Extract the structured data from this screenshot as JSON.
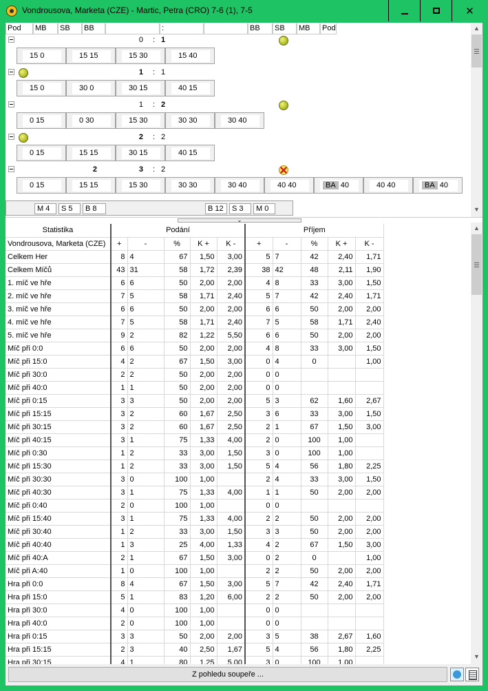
{
  "window": {
    "title": "Vondrousova, Marketa (CZE) - Martic, Petra (CRO) 7-6 (1), 7-5"
  },
  "upper": {
    "header": [
      "Pod",
      "MB",
      "SB",
      "BB",
      "",
      ":",
      "",
      "BB",
      "SB",
      "MB",
      "Pod"
    ],
    "games": [
      {
        "left": "",
        "score": "0",
        "sep": ":",
        "right": "1",
        "right_bold": true,
        "left_bold": false,
        "server": "right",
        "points": [
          "15 0",
          "15 15",
          "15 30",
          "15 40"
        ]
      },
      {
        "left": "",
        "score": "1",
        "sep": ":",
        "right": "1",
        "right_bold": false,
        "left_bold": true,
        "server": "left",
        "points": [
          "15 0",
          "30 0",
          "30 15",
          "40 15"
        ]
      },
      {
        "left": "",
        "score": "1",
        "sep": ":",
        "right": "2",
        "right_bold": true,
        "left_bold": false,
        "server": "right",
        "points": [
          "0 15",
          "0 30",
          "15 30",
          "30 30",
          "30 40"
        ]
      },
      {
        "left": "",
        "score": "2",
        "sep": ":",
        "right": "2",
        "right_bold": false,
        "left_bold": true,
        "server": "left",
        "points": [
          "0 15",
          "15 15",
          "30 15",
          "40 15"
        ]
      },
      {
        "left": "2",
        "score": "3",
        "sep": ":",
        "right": "2",
        "right_bold": false,
        "left_bold": true,
        "server": "break",
        "points": [
          "0 15",
          "15 15",
          "15 30",
          "30 30",
          "30 40",
          "40 40",
          "BA|40",
          "40 40",
          "BA|40"
        ]
      }
    ],
    "bottom_stats": {
      "mb_l": "M 4",
      "sb_l": "S 5",
      "bb_l": "B 8",
      "bb_r": "B 12",
      "sb_r": "S 3",
      "mb_r": "M 0"
    }
  },
  "stats": {
    "header1": {
      "stat": "Statistika",
      "serve": "Podání",
      "return": "Příjem"
    },
    "header2": {
      "player": "Vondrousova, Marketa (CZE)",
      "cols": [
        "+",
        "-",
        "%",
        "K +",
        "K -",
        "+",
        "-",
        "%",
        "K +",
        "K -"
      ]
    },
    "rows": [
      [
        "Celkem Her",
        "8",
        "4",
        "67",
        "1,50",
        "3,00",
        "5",
        "7",
        "42",
        "2,40",
        "1,71"
      ],
      [
        "Celkem Míčů",
        "43",
        "31",
        "58",
        "1,72",
        "2,39",
        "38",
        "42",
        "48",
        "2,11",
        "1,90"
      ],
      [
        "1. míč ve hře",
        "6",
        "6",
        "50",
        "2,00",
        "2,00",
        "4",
        "8",
        "33",
        "3,00",
        "1,50"
      ],
      [
        "2. míč ve hře",
        "7",
        "5",
        "58",
        "1,71",
        "2,40",
        "5",
        "7",
        "42",
        "2,40",
        "1,71"
      ],
      [
        "3. míč ve hře",
        "6",
        "6",
        "50",
        "2,00",
        "2,00",
        "6",
        "6",
        "50",
        "2,00",
        "2,00"
      ],
      [
        "4. míč ve hře",
        "7",
        "5",
        "58",
        "1,71",
        "2,40",
        "7",
        "5",
        "58",
        "1,71",
        "2,40"
      ],
      [
        "5. míč ve hře",
        "9",
        "2",
        "82",
        "1,22",
        "5,50",
        "6",
        "6",
        "50",
        "2,00",
        "2,00"
      ],
      [
        "Míč při 0:0",
        "6",
        "6",
        "50",
        "2,00",
        "2,00",
        "4",
        "8",
        "33",
        "3,00",
        "1,50"
      ],
      [
        "Míč při 15:0",
        "4",
        "2",
        "67",
        "1,50",
        "3,00",
        "0",
        "4",
        "0",
        "",
        "1,00"
      ],
      [
        "Míč při 30:0",
        "2",
        "2",
        "50",
        "2,00",
        "2,00",
        "0",
        "0",
        "",
        "",
        ""
      ],
      [
        "Míč při 40:0",
        "1",
        "1",
        "50",
        "2,00",
        "2,00",
        "0",
        "0",
        "",
        "",
        ""
      ],
      [
        "Míč při 0:15",
        "3",
        "3",
        "50",
        "2,00",
        "2,00",
        "5",
        "3",
        "62",
        "1,60",
        "2,67"
      ],
      [
        "Míč při 15:15",
        "3",
        "2",
        "60",
        "1,67",
        "2,50",
        "3",
        "6",
        "33",
        "3,00",
        "1,50"
      ],
      [
        "Míč při 30:15",
        "3",
        "2",
        "60",
        "1,67",
        "2,50",
        "2",
        "1",
        "67",
        "1,50",
        "3,00"
      ],
      [
        "Míč při 40:15",
        "3",
        "1",
        "75",
        "1,33",
        "4,00",
        "2",
        "0",
        "100",
        "1,00",
        ""
      ],
      [
        "Míč při 0:30",
        "1",
        "2",
        "33",
        "3,00",
        "1,50",
        "3",
        "0",
        "100",
        "1,00",
        ""
      ],
      [
        "Míč při 15:30",
        "1",
        "2",
        "33",
        "3,00",
        "1,50",
        "5",
        "4",
        "56",
        "1,80",
        "2,25"
      ],
      [
        "Míč při 30:30",
        "3",
        "0",
        "100",
        "1,00",
        "",
        "2",
        "4",
        "33",
        "3,00",
        "1,50"
      ],
      [
        "Míč při 40:30",
        "3",
        "1",
        "75",
        "1,33",
        "4,00",
        "1",
        "1",
        "50",
        "2,00",
        "2,00"
      ],
      [
        "Míč při 0:40",
        "2",
        "0",
        "100",
        "1,00",
        "",
        "0",
        "0",
        "",
        "",
        ""
      ],
      [
        "Míč při 15:40",
        "3",
        "1",
        "75",
        "1,33",
        "4,00",
        "2",
        "2",
        "50",
        "2,00",
        "2,00"
      ],
      [
        "Míč při 30:40",
        "1",
        "2",
        "33",
        "3,00",
        "1,50",
        "3",
        "3",
        "50",
        "2,00",
        "2,00"
      ],
      [
        "Míč při 40:40",
        "1",
        "3",
        "25",
        "4,00",
        "1,33",
        "4",
        "2",
        "67",
        "1,50",
        "3,00"
      ],
      [
        "Míč při 40:A",
        "2",
        "1",
        "67",
        "1,50",
        "3,00",
        "0",
        "2",
        "0",
        "",
        "1,00"
      ],
      [
        "Míč při A:40",
        "1",
        "0",
        "100",
        "1,00",
        "",
        "2",
        "2",
        "50",
        "2,00",
        "2,00"
      ],
      [
        "Hra při 0:0",
        "8",
        "4",
        "67",
        "1,50",
        "3,00",
        "5",
        "7",
        "42",
        "2,40",
        "1,71"
      ],
      [
        "Hra při 15:0",
        "5",
        "1",
        "83",
        "1,20",
        "6,00",
        "2",
        "2",
        "50",
        "2,00",
        "2,00"
      ],
      [
        "Hra při 30:0",
        "4",
        "0",
        "100",
        "1,00",
        "",
        "0",
        "0",
        "",
        "",
        ""
      ],
      [
        "Hra při 40:0",
        "2",
        "0",
        "100",
        "1,00",
        "",
        "0",
        "0",
        "",
        "",
        ""
      ],
      [
        "Hra při 0:15",
        "3",
        "3",
        "50",
        "2,00",
        "2,00",
        "3",
        "5",
        "38",
        "2,67",
        "1,60"
      ],
      [
        "Hra při 15:15",
        "2",
        "3",
        "40",
        "2,50",
        "1,67",
        "5",
        "4",
        "56",
        "1,80",
        "2,25"
      ],
      [
        "Hra při 30:15",
        "4",
        "1",
        "80",
        "1,25",
        "5,00",
        "3",
        "0",
        "100",
        "1,00",
        ""
      ]
    ]
  },
  "footer": {
    "button": "Z pohledu soupeře ..."
  },
  "colors": {
    "titlebar": "#1ec363",
    "row_border": "#d8d8d8"
  }
}
